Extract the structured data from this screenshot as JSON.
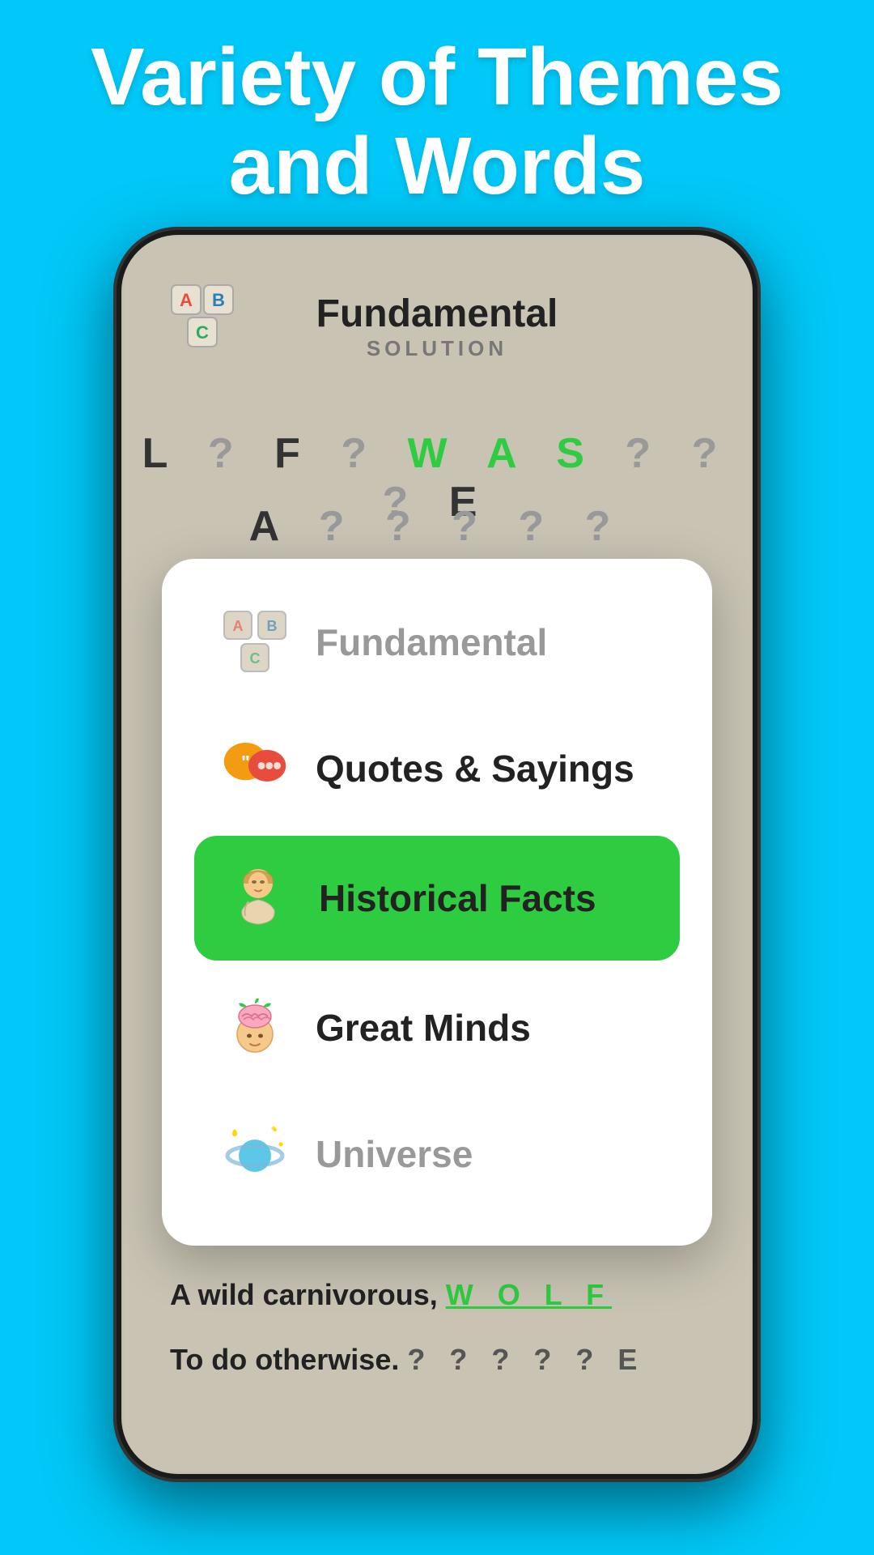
{
  "header": {
    "title_line1": "Variety of Themes",
    "title_line2": "and Words"
  },
  "game": {
    "label": "Fundamental",
    "solution_label": "SOLUTION",
    "row1": "L ? F ? W A S ? ? ? E",
    "row2": "A ? ? ? ? ?",
    "clue1_text": "A wild carnivorous,",
    "clue1_answer": "W O L F",
    "clue2_text": "To do otherwise.",
    "clue2_answer": "? ? ? ? ? E"
  },
  "menu": {
    "items": [
      {
        "id": "fundamental",
        "label": "Fundamental",
        "active": false,
        "disabled": true
      },
      {
        "id": "quotes",
        "label": "Quotes & Sayings",
        "active": false,
        "disabled": false
      },
      {
        "id": "historical",
        "label": "Historical Facts",
        "active": true,
        "disabled": false
      },
      {
        "id": "minds",
        "label": "Great Minds",
        "active": false,
        "disabled": false
      },
      {
        "id": "universe",
        "label": "Universe",
        "active": false,
        "disabled": true
      }
    ]
  },
  "colors": {
    "background": "#00c8f8",
    "active_green": "#2ecc40",
    "card_bg": "#ffffff"
  }
}
